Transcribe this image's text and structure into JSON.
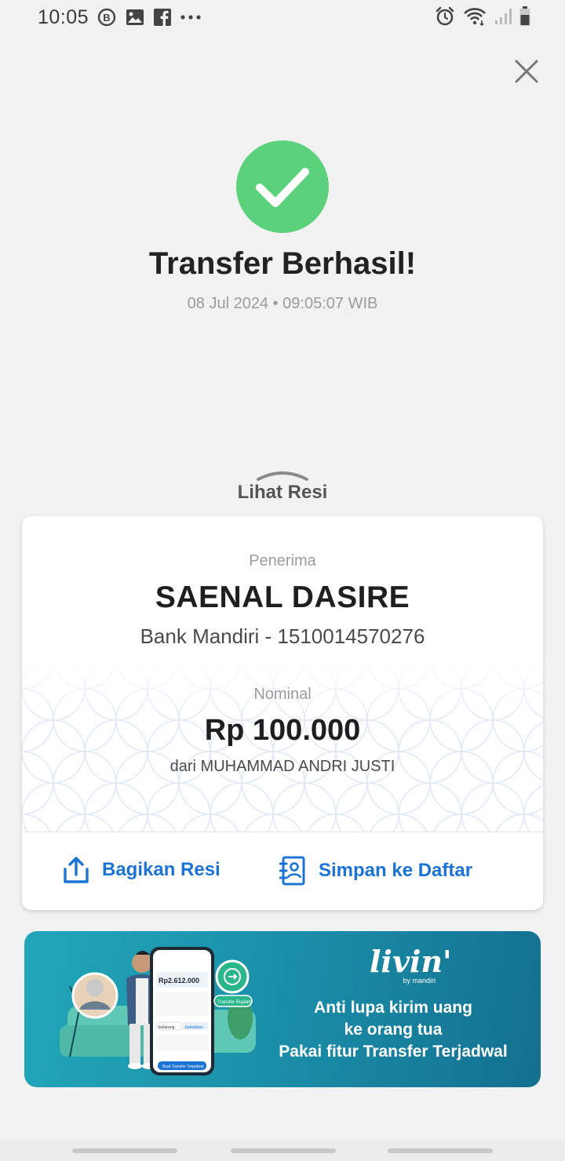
{
  "status_bar": {
    "time": "10:05",
    "left_icons": [
      "b-circle-icon",
      "image-icon",
      "facebook-icon",
      "more-dots-icon"
    ],
    "right_icons": [
      "alarm-icon",
      "wifi-icon",
      "signal-icon",
      "battery-icon"
    ]
  },
  "header": {
    "close_icon": "close-icon",
    "title": "Transfer Berhasil!",
    "datetime": "08 Jul 2024 • 09:05:07 WIB",
    "success_color": "#5bd17c"
  },
  "receipt": {
    "toggle_label": "Lihat Resi",
    "recipient_label": "Penerima",
    "recipient_name": "SAENAL DASIRE",
    "recipient_bank": "Bank Mandiri - 1510014570276",
    "amount_label": "Nominal",
    "amount": "Rp 100.000",
    "sender": "dari MUHAMMAD ANDRI JUSTI",
    "actions": {
      "share_label": "Bagikan Resi",
      "save_label": "Simpan ke Daftar"
    },
    "accent_color": "#1c73d6"
  },
  "banner": {
    "logo_text": "livin'",
    "logo_sub": "by mandiri",
    "line1": "Anti lupa kirim uang",
    "line2": "ke orang tua",
    "line3": "Pakai fitur Transfer Terjadwal",
    "phone_amount": "Rp2.612.000",
    "phone_button": "Transfer Rupiah",
    "phone_tab_now": "Sekarang",
    "phone_tab_scheduled": "Jadwalkan",
    "phone_cta": "Buat Transfer Terjadwal"
  }
}
